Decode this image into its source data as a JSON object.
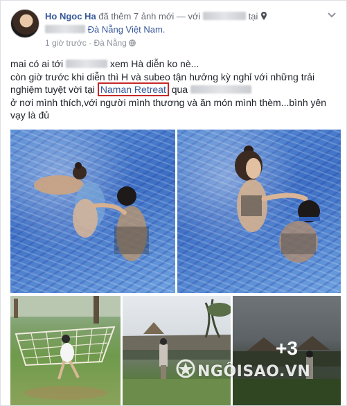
{
  "post": {
    "author": "Ho Ngoc Ha",
    "action": "đã thêm 7 ảnh mới — với",
    "at": "tại",
    "location": "Đà Nẵng Việt Nam.",
    "time": "1 giờ trước",
    "place": "Đà Nẵng",
    "text_line1_before": "mai có ai tới",
    "text_line1_after": "xem Hà diễn ko nè...",
    "text_line2": "còn giờ trước khi diễn thì H và subeo tận hưởng kỳ nghỉ với những trải",
    "text_line3_before": "nghiệm tuyệt vời tại",
    "tagged_place": "Naman Retreat",
    "text_line3_after": "qua",
    "text_line4": "ở nơi mình thích,với người mình thương và ăn món mình thèm...bình yên",
    "text_line5": "vạy là đủ",
    "more_photos": "+3",
    "watermark": "NGÔISAO.VN"
  },
  "colors": {
    "link": "#365899",
    "highlight_box": "#c62828",
    "pool": "#4a7fd0"
  },
  "icons": [
    "location-pin-icon",
    "globe-icon",
    "chevron-down-icon"
  ]
}
